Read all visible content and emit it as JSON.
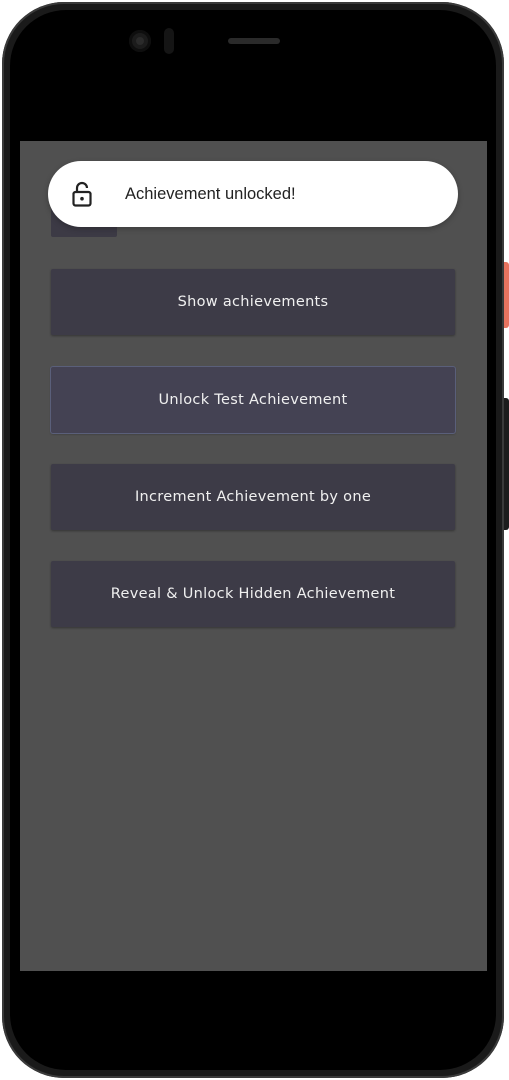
{
  "toast": {
    "icon": "lock-open-icon",
    "message": "Achievement unlocked!"
  },
  "buttons": {
    "show_achievements": "Show achievements",
    "unlock_test": "Unlock Test Achievement",
    "increment": "Increment Achievement by one",
    "reveal_unlock_hidden": "Reveal & Unlock Hidden Achievement"
  },
  "colors": {
    "app_background": "#505050",
    "button_background": "#3d3b47",
    "button_text": "#f0f0f0",
    "toast_background": "#ffffff",
    "side_button_accent": "#e8735f"
  }
}
